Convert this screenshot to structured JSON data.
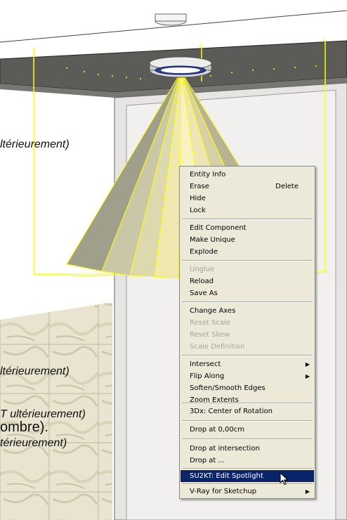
{
  "overlay_texts": [
    "ltérieurement)",
    "ltérieurement)",
    "T ultérieurement)",
    "ombre).",
    "térieurement)"
  ],
  "context_menu": {
    "items": [
      {
        "label": "Entity Info"
      },
      {
        "label": "Erase",
        "shortcut": "Delete"
      },
      {
        "label": "Hide"
      },
      {
        "label": "Lock"
      },
      {
        "label": "Edit Component"
      },
      {
        "label": "Make Unique"
      },
      {
        "label": "Explode"
      },
      {
        "label": "Unglue",
        "disabled": true
      },
      {
        "label": "Reload"
      },
      {
        "label": "Save As"
      },
      {
        "label": "Change Axes"
      },
      {
        "label": "Reset Scale",
        "disabled": true
      },
      {
        "label": "Reset Skew",
        "disabled": true
      },
      {
        "label": "Scale Definition",
        "disabled": true
      },
      {
        "label": "Intersect",
        "submenu": true
      },
      {
        "label": "Flip Along",
        "submenu": true
      },
      {
        "label": "Soften/Smooth Edges"
      },
      {
        "label": "Zoom Extents"
      },
      {
        "label": "3Dx: Center of Rotation"
      },
      {
        "label": "Drop at 0,00cm"
      },
      {
        "label": "Drop at intersection"
      },
      {
        "label": "Drop at ..."
      },
      {
        "label": "SU2KT: Edit Spotlight",
        "highlighted": true
      },
      {
        "label": "V-Ray for Sketchup",
        "submenu": true
      }
    ],
    "submenu_arrow": "▶"
  },
  "colors": {
    "selection": "#ffff00",
    "menu_highlight": "#0a246a",
    "menu_background": "#ece9d8",
    "ceiling": "#5b5b58"
  },
  "icons": [
    "mouse-cursor-icon",
    "submenu-arrow-icon"
  ]
}
